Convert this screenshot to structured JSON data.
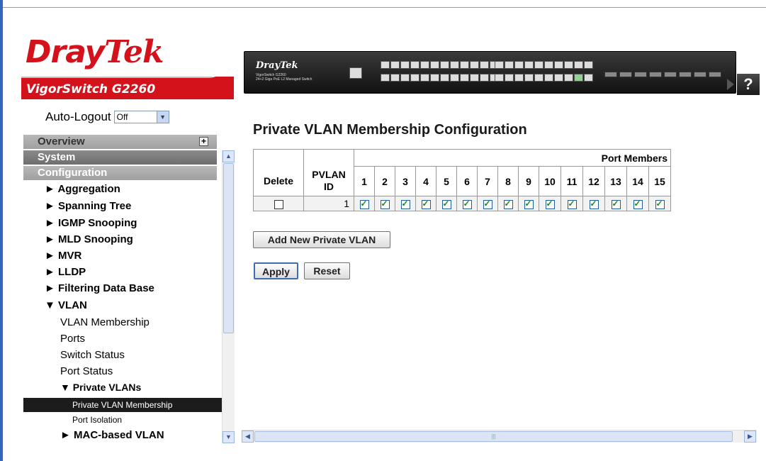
{
  "header": {
    "brand_dray": "Dray",
    "brand_tek": "Tek",
    "model_title": "VigorSwitch G2260",
    "device_brand": "DrayTek",
    "device_model_line1": "VigorSwitch G2260",
    "device_model_line2": "24+2 Giga PoE L2 Managed Switch",
    "help_label": "?",
    "brand_red": "#d4121b"
  },
  "sidebar": {
    "auto_logout_label": "Auto-Logout",
    "auto_logout_value": "Off",
    "overview_label": "Overview",
    "system_label": "System",
    "configuration_label": "Configuration",
    "items": [
      {
        "label": "► Aggregation"
      },
      {
        "label": "► Spanning Tree"
      },
      {
        "label": "► IGMP Snooping"
      },
      {
        "label": "► MLD Snooping"
      },
      {
        "label": "► MVR"
      },
      {
        "label": "► LLDP"
      },
      {
        "label": "► Filtering Data Base"
      },
      {
        "label": "▼ VLAN"
      },
      {
        "label": "VLAN Membership"
      },
      {
        "label": "Ports"
      },
      {
        "label": "Switch Status"
      },
      {
        "label": "Port Status"
      },
      {
        "label": "▼ Private VLANs"
      },
      {
        "label": "Private VLAN Membership"
      },
      {
        "label": "Port Isolation"
      },
      {
        "label": "► MAC-based VLAN"
      }
    ]
  },
  "main": {
    "title": "Private VLAN Membership Configuration",
    "table": {
      "port_members_label": "Port Members",
      "delete_label": "Delete",
      "pvlan_id_label_1": "PVLAN",
      "pvlan_id_label_2": "ID",
      "ports": [
        "1",
        "2",
        "3",
        "4",
        "5",
        "6",
        "7",
        "8",
        "9",
        "10",
        "11",
        "12",
        "13",
        "14",
        "15"
      ],
      "row": {
        "pvlan_id": "1",
        "delete_checked": false,
        "members_checked": true
      }
    },
    "add_button": "Add New Private VLAN",
    "apply_button": "Apply",
    "reset_button": "Reset"
  }
}
